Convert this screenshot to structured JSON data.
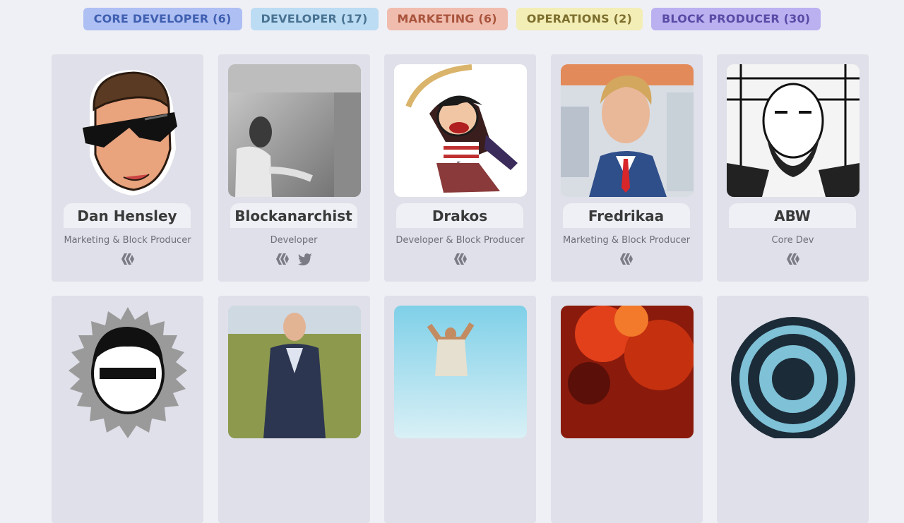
{
  "filters": [
    {
      "label": "CORE DEVELOPER (6)"
    },
    {
      "label": "DEVELOPER (17)"
    },
    {
      "label": "MARKETING (6)"
    },
    {
      "label": "OPERATIONS (2)"
    },
    {
      "label": "BLOCK PRODUCER (30)"
    }
  ],
  "members": [
    {
      "name": "Dan Hensley",
      "role": "Marketing & Block Producer",
      "links": [
        "hive-icon"
      ]
    },
    {
      "name": "Blockanarchist",
      "role": "Developer",
      "links": [
        "hive-icon",
        "twitter-icon"
      ]
    },
    {
      "name": "Drakos",
      "role": "Developer & Block Producer",
      "links": [
        "hive-icon"
      ]
    },
    {
      "name": "Fredrikaa",
      "role": "Marketing & Block Producer",
      "links": [
        "hive-icon"
      ]
    },
    {
      "name": "ABW",
      "role": "Core Dev",
      "links": [
        "hive-icon"
      ]
    }
  ],
  "colors": {
    "background": "#eff0f5",
    "card": "#dfe0e9",
    "icon": "#7b7b85"
  }
}
